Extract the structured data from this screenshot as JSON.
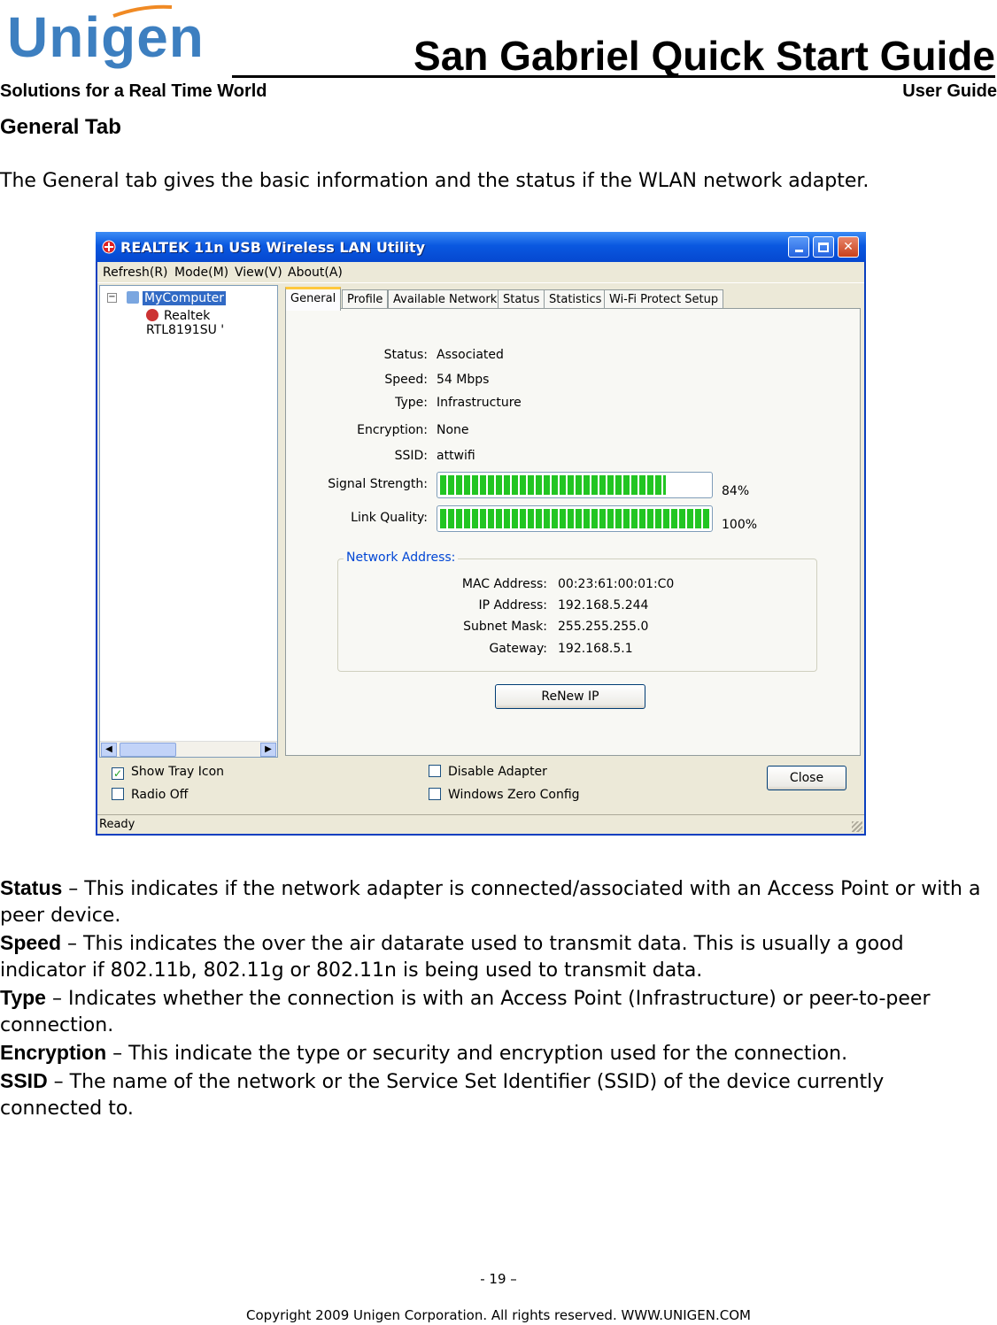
{
  "header": {
    "logo_text": "Unigen",
    "title": "San Gabriel Quick Start Guide",
    "tagline": "Solutions for a Real Time World",
    "doc_type": "User Guide"
  },
  "section": {
    "heading": "General Tab",
    "intro": "The General tab gives the basic information and the status if the WLAN network adapter."
  },
  "window": {
    "title": "REALTEK 11n USB Wireless LAN Utility",
    "app_icon": "realtek-icon",
    "controls": {
      "minimize": "minimize-icon",
      "maximize": "maximize-icon",
      "close": "close-icon"
    },
    "menu": [
      "Refresh(R)",
      "Mode(M)",
      "View(V)",
      "About(A)"
    ],
    "tree": {
      "root": "MyComputer",
      "child": "Realtek RTL8191SU '"
    },
    "tabs": [
      "General",
      "Profile",
      "Available Network",
      "Status",
      "Statistics",
      "Wi-Fi Protect Setup"
    ],
    "active_tab": "General",
    "general": {
      "status_label": "Status:",
      "status_value": "Associated",
      "speed_label": "Speed:",
      "speed_value": "54 Mbps",
      "type_label": "Type:",
      "type_value": "Infrastructure",
      "encryption_label": "Encryption:",
      "encryption_value": "None",
      "ssid_label": "SSID:",
      "ssid_value": "attwifi",
      "signal_label": "Signal Strength:",
      "signal_text": "84%",
      "signal_value": 84,
      "link_label": "Link Quality:",
      "link_text": "100%",
      "link_value": 100,
      "network_title": "Network Address:",
      "mac_label": "MAC Address:",
      "mac_value": "00:23:61:00:01:C0",
      "ip_label": "IP Address:",
      "ip_value": "192.168.5.244",
      "mask_label": "Subnet Mask:",
      "mask_value": "255.255.255.0",
      "gateway_label": "Gateway:",
      "gateway_value": "192.168.5.1",
      "renew_button": "ReNew IP"
    },
    "options": {
      "show_tray_icon": {
        "label": "Show Tray Icon",
        "checked": true
      },
      "radio_off": {
        "label": "Radio Off",
        "checked": false
      },
      "disable_adapter": {
        "label": "Disable Adapter",
        "checked": false
      },
      "windows_zero_config": {
        "label": "Windows Zero Config",
        "checked": false
      }
    },
    "close_button": "Close",
    "status_bar": "Ready"
  },
  "definitions": [
    {
      "term": "Status",
      "text": " – This indicates if the network adapter is connected/associated with an Access Point or with a peer device."
    },
    {
      "term": "Speed",
      "text": " – This indicates the  over the air datarate used to transmit data. This is usually a good indicator if 802.11b, 802.11g or 802.11n is being used to transmit data."
    },
    {
      "term": "Type",
      "text": " – Indicates whether the connection is with an Access Point (Infrastructure) or peer-to-peer connection."
    },
    {
      "term": "Encryption",
      "text": " – This indicate the type or security and encryption used for the connection."
    },
    {
      "term": "SSID",
      "text": " – The name of the network or the Service Set Identifier (SSID) of the device currently connected to."
    }
  ],
  "footer": {
    "page": "- 19 –",
    "copyright": "Copyright 2009 Unigen Corporation. All rights reserved. WWW.UNIGEN.COM"
  }
}
